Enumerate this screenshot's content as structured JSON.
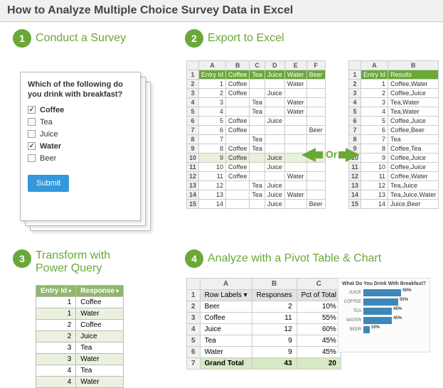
{
  "title": "How to Analyze Multiple Choice Survey Data in Excel",
  "steps": {
    "s1": {
      "num": "1",
      "label": "Conduct a Survey"
    },
    "s2": {
      "num": "2",
      "label": "Export to Excel"
    },
    "s3": {
      "num": "3",
      "label": "Transform with Power Query"
    },
    "s4": {
      "num": "4",
      "label": "Analyze with a Pivot Table & Chart"
    }
  },
  "survey": {
    "question": "Which of the following do you drink with breakfast?",
    "options": [
      {
        "label": "Coffee",
        "checked": true
      },
      {
        "label": "Tea",
        "checked": false
      },
      {
        "label": "Juice",
        "checked": false
      },
      {
        "label": "Water",
        "checked": true
      },
      {
        "label": "Beer",
        "checked": false
      }
    ],
    "submit": "Submit"
  },
  "export_left": {
    "cols": [
      "A",
      "B",
      "C",
      "D",
      "E",
      "F"
    ],
    "headers": [
      "Entry Id",
      "Coffee",
      "Tea",
      "Juice",
      "Water",
      "Beer"
    ],
    "rows": [
      [
        "1",
        "Coffee",
        "",
        "",
        "Water",
        ""
      ],
      [
        "2",
        "Coffee",
        "",
        "Juice",
        "",
        ""
      ],
      [
        "3",
        "",
        "Tea",
        "",
        "Water",
        ""
      ],
      [
        "4",
        "",
        "Tea",
        "",
        "Water",
        ""
      ],
      [
        "5",
        "Coffee",
        "",
        "Juice",
        "",
        ""
      ],
      [
        "6",
        "Coffee",
        "",
        "",
        "",
        "Beer"
      ],
      [
        "7",
        "",
        "Tea",
        "",
        "",
        ""
      ],
      [
        "8",
        "Coffee",
        "Tea",
        "",
        "",
        ""
      ],
      [
        "9",
        "Coffee",
        "",
        "Juice",
        "",
        ""
      ],
      [
        "10",
        "Coffee",
        "",
        "Juice",
        "",
        ""
      ],
      [
        "11",
        "Coffee",
        "",
        "",
        "Water",
        ""
      ],
      [
        "12",
        "",
        "Tea",
        "Juice",
        "",
        ""
      ],
      [
        "13",
        "",
        "Tea",
        "Juice",
        "Water",
        ""
      ],
      [
        "14",
        "",
        "",
        "Juice",
        "",
        "Beer"
      ]
    ]
  },
  "export_right": {
    "cols": [
      "A",
      "B"
    ],
    "headers": [
      "Entry Id",
      "Results"
    ],
    "rows": [
      [
        "1",
        "Coffee,Water"
      ],
      [
        "2",
        "Coffee,Juice"
      ],
      [
        "3",
        "Tea,Water"
      ],
      [
        "4",
        "Tea,Water"
      ],
      [
        "5",
        "Coffee,Juice"
      ],
      [
        "6",
        "Coffee,Beer"
      ],
      [
        "7",
        "Tea"
      ],
      [
        "8",
        "Coffee,Tea"
      ],
      [
        "9",
        "Coffee,Juice"
      ],
      [
        "10",
        "Coffee,Juice"
      ],
      [
        "11",
        "Coffee,Water"
      ],
      [
        "12",
        "Tea,Juice"
      ],
      [
        "13",
        "Tea,Juice,Water"
      ],
      [
        "14",
        "Juice,Beer"
      ]
    ]
  },
  "or_text": "Or",
  "transform": {
    "headers": [
      "Entry Id",
      "Response"
    ],
    "rows": [
      [
        "1",
        "Coffee"
      ],
      [
        "1",
        "Water"
      ],
      [
        "2",
        "Coffee"
      ],
      [
        "2",
        "Juice"
      ],
      [
        "3",
        "Tea"
      ],
      [
        "3",
        "Water"
      ],
      [
        "4",
        "Tea"
      ],
      [
        "4",
        "Water"
      ]
    ]
  },
  "pivot": {
    "cols": [
      "A",
      "B",
      "C"
    ],
    "headers": [
      "Row Labels",
      "Responses",
      "Pct of Total"
    ],
    "rows": [
      [
        "Beer",
        "2",
        "10%"
      ],
      [
        "Coffee",
        "11",
        "55%"
      ],
      [
        "Juice",
        "12",
        "60%"
      ],
      [
        "Tea",
        "9",
        "45%"
      ],
      [
        "Water",
        "9",
        "45%"
      ]
    ],
    "grand": [
      "Grand Total",
      "43",
      "20"
    ]
  },
  "chart_data": {
    "type": "bar",
    "title": "What Do You Drink With Breakfast?",
    "categories": [
      "JUICE",
      "COFFEE",
      "TEA",
      "WATER",
      "BEER"
    ],
    "values": [
      60,
      55,
      45,
      45,
      10
    ],
    "value_labels": [
      "60%",
      "55%",
      "45%",
      "45%",
      "10%"
    ],
    "xlim": [
      0,
      100
    ]
  }
}
